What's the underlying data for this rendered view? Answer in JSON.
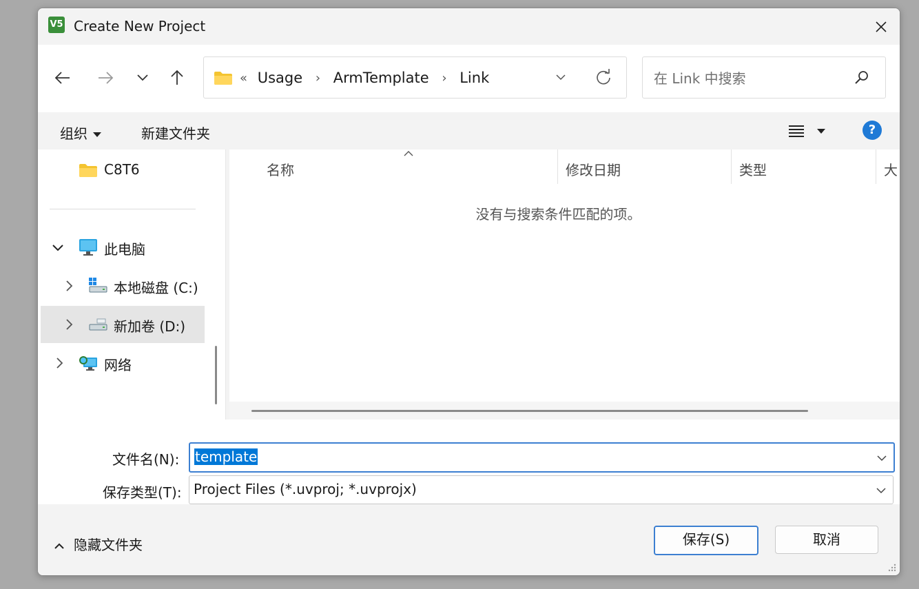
{
  "window": {
    "title": "Create New Project",
    "app_icon_text": "V5"
  },
  "nav": {
    "path_overflow": "«",
    "breadcrumbs": [
      "Usage",
      "ArmTemplate",
      "Link"
    ],
    "search_placeholder": "在 Link 中搜索"
  },
  "toolbar": {
    "organize_label": "组织",
    "new_folder_label": "新建文件夹",
    "help_label": "?"
  },
  "sidebar": {
    "items": [
      {
        "label": "C8T6",
        "icon": "folder-icon"
      },
      {
        "label": "此电脑",
        "icon": "computer-icon",
        "expanded": true
      },
      {
        "label": "本地磁盘 (C:)",
        "icon": "local-disk-icon"
      },
      {
        "label": "新加卷 (D:)",
        "icon": "drive-icon",
        "selected": true
      },
      {
        "label": "网络",
        "icon": "network-icon"
      }
    ]
  },
  "filelist": {
    "columns": [
      "名称",
      "修改日期",
      "类型",
      "大"
    ],
    "empty_message": "没有与搜索条件匹配的项。"
  },
  "form": {
    "filename_label": "文件名(N):",
    "filename_value": "template",
    "filetype_label": "保存类型(T):",
    "filetype_value": "Project Files (*.uvproj; *.uvprojx)"
  },
  "footer": {
    "hide_folders_label": "隐藏文件夹",
    "save_label": "保存(S)",
    "cancel_label": "取消"
  },
  "colors": {
    "accent": "#0078d7",
    "focus_border": "#3c7fd1",
    "folder": "#f4c430"
  }
}
